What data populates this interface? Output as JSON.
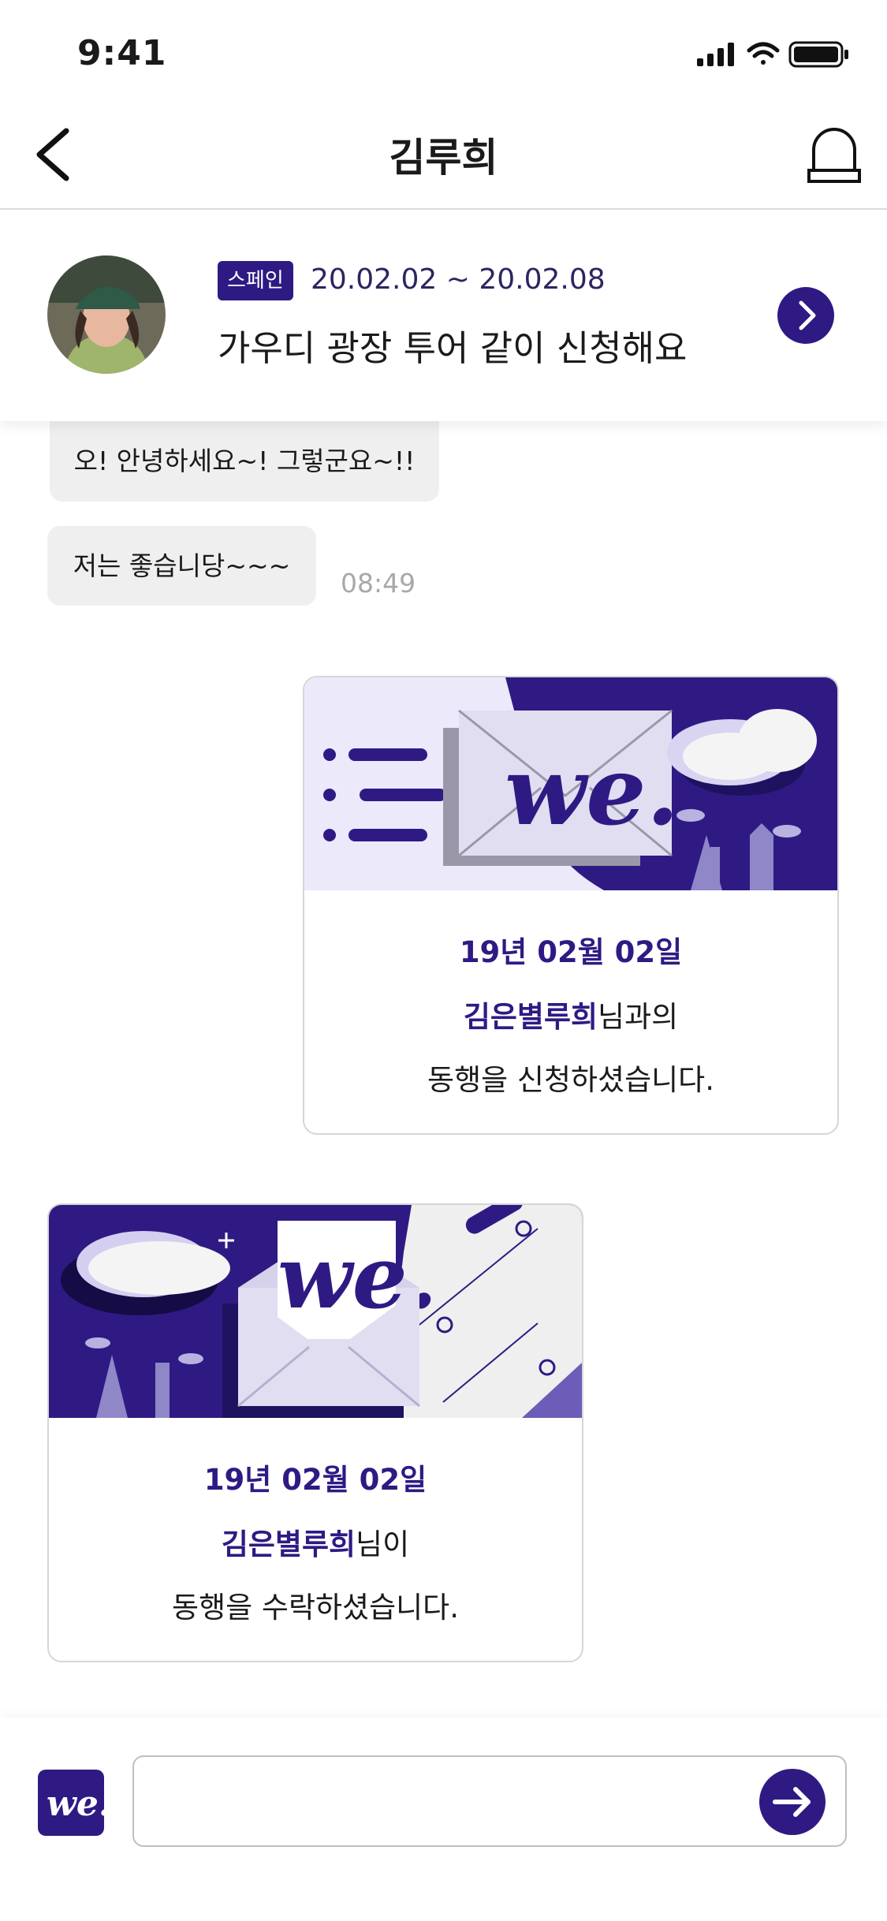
{
  "status_bar": {
    "time": "9:41"
  },
  "nav": {
    "title": "김루희"
  },
  "trip": {
    "country": "스페인",
    "dates": "20.02.02 ~ 20.02.08",
    "title": "가우디 광장 투어 같이 신청해요"
  },
  "messages": [
    {
      "text": "오! 안녕하세요~! 그렇군요~!!"
    },
    {
      "text": "저는 좋습니당~~~",
      "time": "08:49"
    }
  ],
  "cards": {
    "sent": {
      "date": "19년 02월 02일",
      "name": "김은별루희",
      "suffix": "님과의",
      "line3": "동행을 신청하셨습니다."
    },
    "received": {
      "date": "19년 02월 02일",
      "name": "김은별루희",
      "suffix": "님이",
      "line3": "동행을  수락하셨습니다."
    }
  },
  "input": {
    "placeholder": ""
  },
  "icons": {
    "back": "chevron-left-icon",
    "alarm": "bell-icon",
    "arrow": "chevron-right-icon",
    "send": "arrow-right-icon",
    "brand": "we-logo-icon"
  },
  "colors": {
    "accent": "#2f1a84",
    "bubble": "#efefef",
    "card_border": "#d6d6d6"
  }
}
